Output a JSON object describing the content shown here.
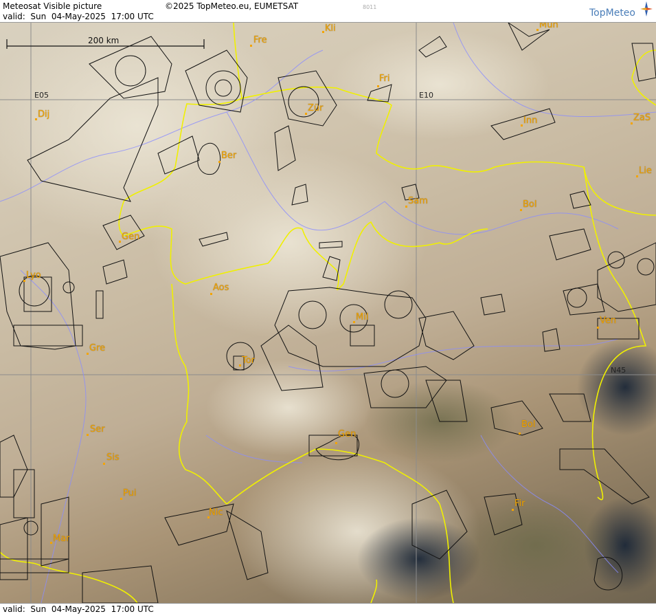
{
  "header": {
    "title": "Meteosat Visible picture",
    "copyright": "©2025 TopMeteo.eu, EUMETSAT",
    "code": "8011",
    "valid": "valid:  Sun  04-May-2025  17:00 UTC",
    "logo_text": "TopMeteo"
  },
  "footer": {
    "valid": "valid:  Sun  04-May-2025  17:00 UTC"
  },
  "scale_bar": {
    "label": "200 km"
  },
  "grid_labels": {
    "e05": "E05",
    "e10": "E10",
    "n45": "N45"
  },
  "cities": [
    {
      "name": "Kli"
    },
    {
      "name": "Mun"
    },
    {
      "name": "Fre"
    },
    {
      "name": "Fri"
    },
    {
      "name": "Dij"
    },
    {
      "name": "Zür"
    },
    {
      "name": "Inn"
    },
    {
      "name": "ZaS"
    },
    {
      "name": "Ber"
    },
    {
      "name": "Lie"
    },
    {
      "name": "Sam"
    },
    {
      "name": "Bol"
    },
    {
      "name": "Gen"
    },
    {
      "name": "Lyo"
    },
    {
      "name": "Aos"
    },
    {
      "name": "Mil"
    },
    {
      "name": "Ven"
    },
    {
      "name": "Gre"
    },
    {
      "name": "Tor"
    },
    {
      "name": "Ser"
    },
    {
      "name": "Gen"
    },
    {
      "name": "Bol"
    },
    {
      "name": "Sis"
    },
    {
      "name": "Pui"
    },
    {
      "name": "Nic"
    },
    {
      "name": "Fir"
    },
    {
      "name": "Mar"
    }
  ],
  "colors": {
    "city": "#f3a400",
    "border": "#f0f000",
    "river": "#8a8cff",
    "airspace": "#111111",
    "grid": "#8c8c8c"
  }
}
